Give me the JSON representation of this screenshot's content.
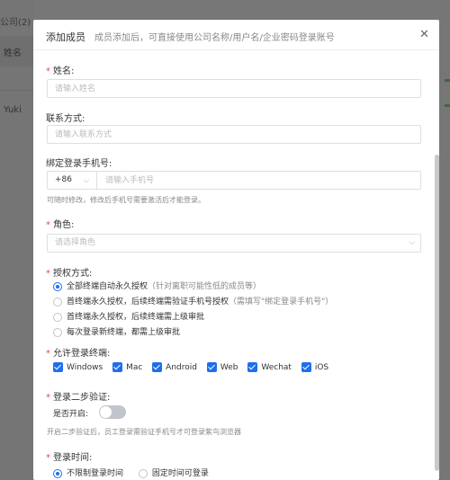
{
  "background": {
    "company_label": "公司(2)",
    "column_name": "姓名",
    "row_name": "Yuki"
  },
  "modal": {
    "title": "添加成员",
    "subtitle": "成员添加后，可直接使用公司名称/用户名/企业密码登录账号",
    "close_icon": "close-icon"
  },
  "form": {
    "name": {
      "label": "姓名:",
      "required": true,
      "placeholder": "请输入姓名",
      "value": ""
    },
    "contact": {
      "label": "联系方式:",
      "required": false,
      "placeholder": "请输入联系方式",
      "value": ""
    },
    "phone": {
      "label": "绑定登录手机号:",
      "country_code": "+86",
      "placeholder": "请输入手机号",
      "hint": "可随时修改，修改后手机号需要激活后才能登录。"
    },
    "role": {
      "label": "角色:",
      "required": true,
      "placeholder": "请选择角色"
    },
    "auth": {
      "label": "授权方式:",
      "required": true,
      "options": [
        {
          "text": "全部终端自动永久授权",
          "note": "（针对离职可能性低的成员等）",
          "selected": true
        },
        {
          "text": "首终端永久授权，后续终端需验证手机号授权",
          "note": "（需填写\"绑定登录手机号\"）",
          "selected": false
        },
        {
          "text": "首终端永久授权，后续终端需上级审批",
          "note": "",
          "selected": false
        },
        {
          "text": "每次登录新终端，都需上级审批",
          "note": "",
          "selected": false
        }
      ]
    },
    "terminals": {
      "label": "允许登录终端:",
      "required": true,
      "options": [
        "Windows",
        "Mac",
        "Android",
        "Web",
        "Wechat",
        "iOS"
      ]
    },
    "two_step": {
      "label": "登录二步验证:",
      "required": true,
      "toggle_label": "是否开启:",
      "enabled": false,
      "hint": "开启二步验证后，员工登录需验证手机号才可登录紫鸟浏览器"
    },
    "login_time": {
      "label": "登录时间:",
      "required": true,
      "options": [
        {
          "text": "不限制登录时间",
          "selected": true
        },
        {
          "text": "固定时间可登录",
          "selected": false
        }
      ]
    }
  },
  "colors": {
    "accent": "#1f6feb",
    "required": "#e5484d",
    "border": "#dcdfe6"
  }
}
